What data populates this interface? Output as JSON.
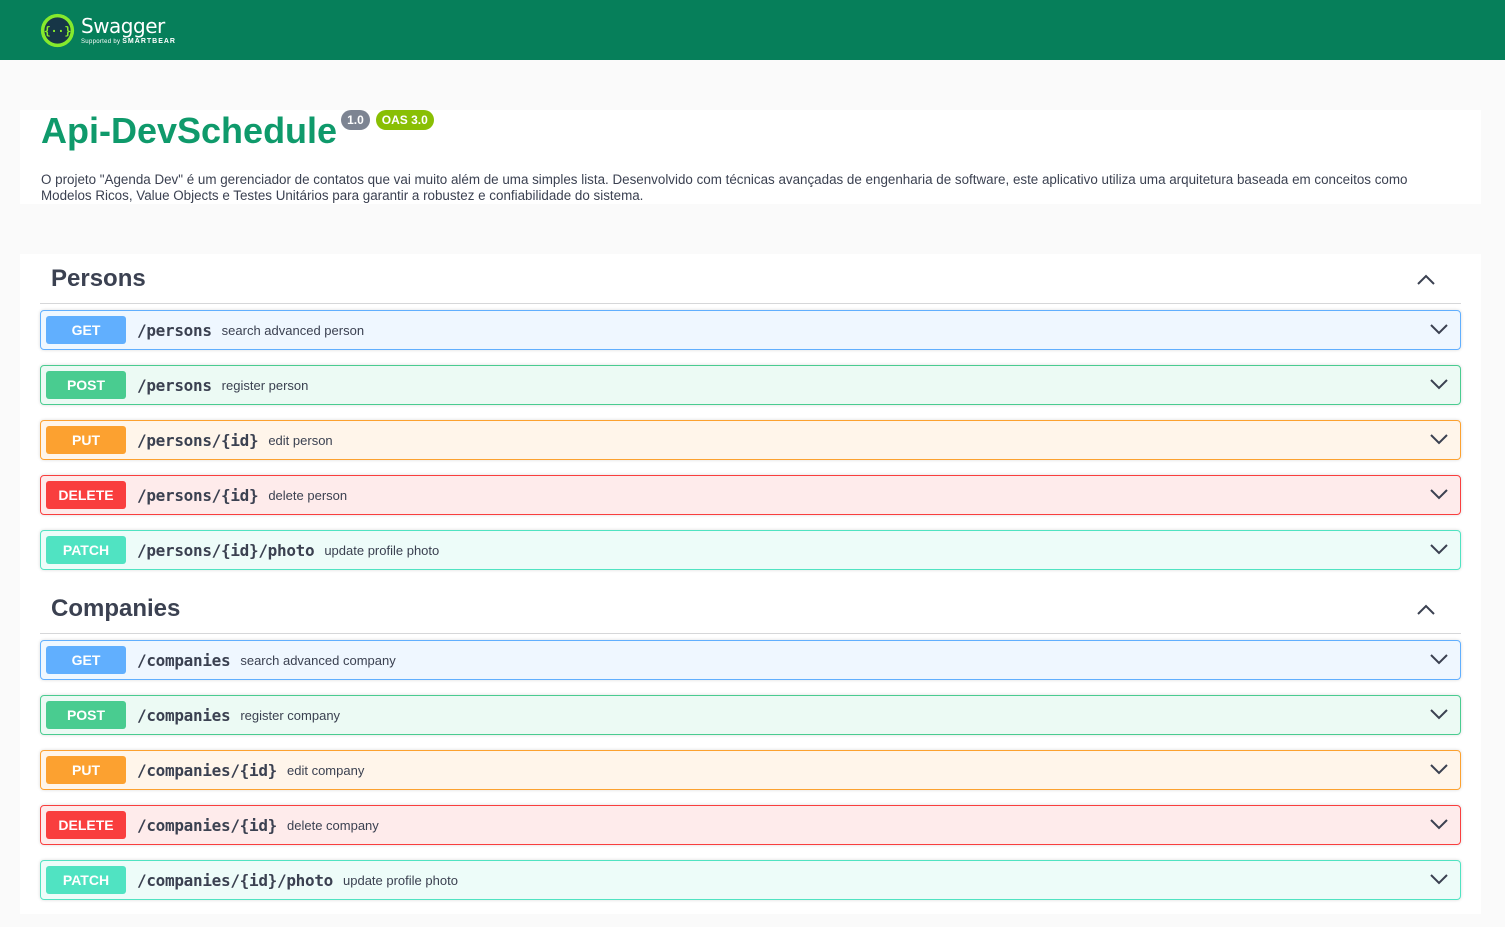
{
  "topbar": {
    "logo_name": "Swagger",
    "logo_sub_prefix": "Supported by",
    "logo_sub_brand": "SMARTBEAR"
  },
  "info": {
    "title": "Api-DevSchedule",
    "version": "1.0",
    "oas": "OAS 3.0",
    "description": "O projeto \"Agenda Dev\" é um gerenciador de contatos que vai muito além de uma simples lista. Desenvolvido com técnicas avançadas de engenharia de software, este aplicativo utiliza uma arquitetura baseada em conceitos como Modelos Ricos, Value Objects e Testes Unitários para garantir a robustez e confiabilidade do sistema."
  },
  "sections": [
    {
      "title": "Persons",
      "operations": [
        {
          "method": "GET",
          "path": "/persons",
          "summary": "search advanced person"
        },
        {
          "method": "POST",
          "path": "/persons",
          "summary": "register person"
        },
        {
          "method": "PUT",
          "path": "/persons/{id}",
          "summary": "edit person"
        },
        {
          "method": "DELETE",
          "path": "/persons/{id}",
          "summary": "delete person"
        },
        {
          "method": "PATCH",
          "path": "/persons/{id}/photo",
          "summary": "update profile photo"
        }
      ]
    },
    {
      "title": "Companies",
      "operations": [
        {
          "method": "GET",
          "path": "/companies",
          "summary": "search advanced company"
        },
        {
          "method": "POST",
          "path": "/companies",
          "summary": "register company"
        },
        {
          "method": "PUT",
          "path": "/companies/{id}",
          "summary": "edit company"
        },
        {
          "method": "DELETE",
          "path": "/companies/{id}",
          "summary": "delete company"
        },
        {
          "method": "PATCH",
          "path": "/companies/{id}/photo",
          "summary": "update profile photo"
        }
      ]
    }
  ],
  "colors": {
    "topbar": "#067f5a",
    "title": "#0f9a6b",
    "get": "#61affe",
    "post": "#49cc90",
    "put": "#fca130",
    "delete": "#f93e3e",
    "patch": "#50e3c2"
  },
  "icons": {
    "logo": "swagger-logo-icon",
    "collapse": "chevron-up-icon",
    "expand": "chevron-down-icon"
  }
}
